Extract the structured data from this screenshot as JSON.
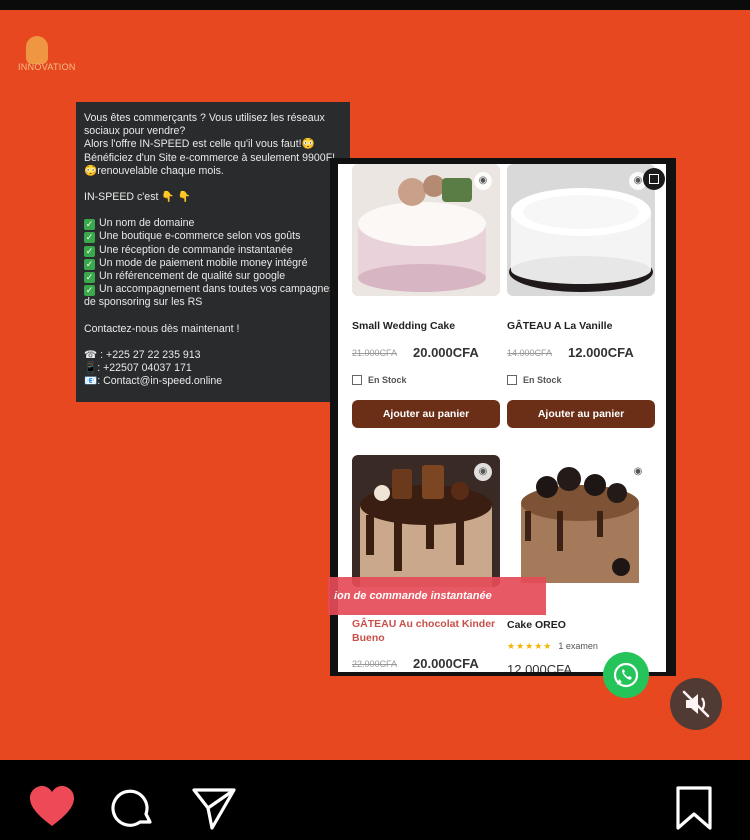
{
  "logo": {
    "text": "INNOVATION"
  },
  "promo": {
    "intro": "Vous êtes commerçants ? Vous utilisez les réseaux sociaux pour vendre?\nAlors l'offre IN-SPEED est celle qu'il vous faut!😳\nBénéficiez d'un Site e-commerce à seulement 9900F!😳renouvelable chaque mois.",
    "heading": "IN-SPEED c'est 👇 👇",
    "features": [
      "Un nom de domaine",
      "Une boutique e-commerce selon vos goûts",
      "Une réception de commande instantanée",
      "Un mode de paiement mobile money intégré",
      "Un référencement de qualité sur google",
      "Un accompagnement dans toutes vos campagnes de sponsoring sur les RS"
    ],
    "contact_heading": "Contactez-nous dès maintenant !",
    "phone_1": "☎ : +225 27 22 235 913",
    "phone_2": "📱: +22507 04037 171",
    "email": "📧: Contact@in-speed.online"
  },
  "shop": {
    "products": [
      {
        "name": "Small Wedding Cake",
        "old_price": "21.000CFA",
        "price": "20.000CFA",
        "stock": "En Stock",
        "button": "Ajouter au panier"
      },
      {
        "name": "GÂTEAU A La Vanille",
        "old_price": "14.000CFA",
        "price": "12.000CFA",
        "stock": "En Stock",
        "button": "Ajouter au panier"
      },
      {
        "name": "GÂTEAU Au chocolat Kinder Bueno",
        "old_price": "22.000CFA",
        "price": "20.000CFA"
      },
      {
        "name": "Cake OREO",
        "price": "12.000CFA",
        "stars": "★★★★★",
        "reviews": "1 examen"
      }
    ],
    "banner_text": "ion de commande instantanée"
  },
  "colors": {
    "background": "#e8481f",
    "button": "#6b2f17",
    "banner": "#e54b57",
    "whatsapp": "#25c45a",
    "like": "#ed4956"
  },
  "icons": {
    "like": "heart-icon",
    "comment": "comment-icon",
    "share": "send-icon",
    "save": "bookmark-icon",
    "mute": "speaker-muted-icon",
    "whatsapp": "whatsapp-icon"
  }
}
